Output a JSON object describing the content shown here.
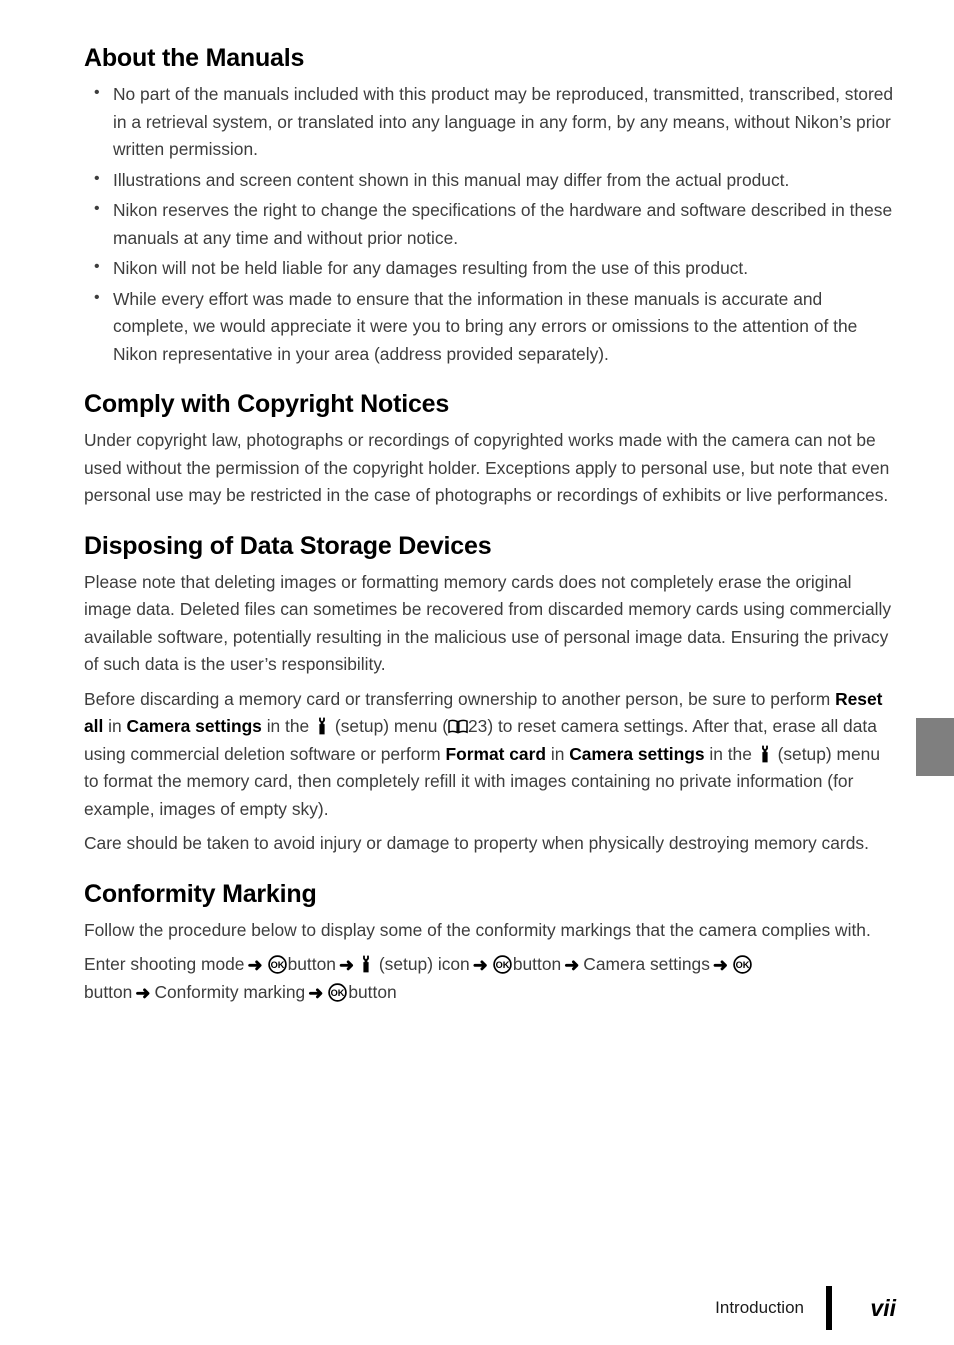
{
  "page": {
    "number": "vii",
    "footer_label": "Introduction"
  },
  "icons": {
    "wrench": "wrench-setup-icon",
    "book": "open-book-reference-icon",
    "ok": "ok-button-icon",
    "arrow": "right-arrow-icon",
    "bullet": "bullet-point"
  },
  "colors": {
    "heading": "#000000",
    "body": "#3d3d3d",
    "tab": "#7f7f7f",
    "footer_rule": "#000000"
  },
  "sections": [
    {
      "heading": "About the Manuals",
      "bullets": [
        "No part of the manuals included with this product may be reproduced, transmitted, transcribed, stored in a retrieval system, or translated into any language in any form, by any means, without Nikon’s prior written permission.",
        "Illustrations and screen content shown in this manual may differ from the actual product.",
        "Nikon reserves the right to change the specifications of the hardware and software described in these manuals at any time and without prior notice.",
        "Nikon will not be held liable for any damages resulting from the use of this product.",
        "While every effort was made to ensure that the information in these manuals is accurate and complete, we would appreciate it were you to bring any errors or omissions to the attention of the Nikon representative in your area (address provided separately)."
      ]
    },
    {
      "heading": "Comply with Copyright Notices",
      "paragraphs": [
        "Under copyright law, photographs or recordings of copyrighted works made with the camera can not be used without the permission of the copyright holder. Exceptions apply to personal use, but note that even personal use may be restricted in the case of photographs or recordings of exhibits or live performances."
      ]
    },
    {
      "heading": "Disposing of Data Storage Devices",
      "paragraphs": [
        "Please note that deleting images or formatting memory cards does not completely erase the original image data. Deleted files can sometimes be recovered from discarded memory cards using commercially available software, potentially resulting in the malicious use of personal image data. Ensuring the privacy of such data is the user’s responsibility.",
        "Care should be taken to avoid injury or damage to property when physically destroying memory cards."
      ]
    },
    {
      "heading": "Conformity Marking",
      "paragraphs": [
        "Follow the procedure below to display some of the conformity markings that the camera complies with."
      ]
    }
  ],
  "disposing_rich": {
    "p2_t1": "Before discarding a memory card or transferring ownership to another person, be sure to perform ",
    "p2_b1": "Reset all",
    "p2_t2": " in ",
    "p2_b2": "Camera settings",
    "p2_t3": " in the ",
    "p2_t4": " (setup) menu (",
    "p2_page_ref": "23",
    "p2_t5": ") to reset camera settings. After that, erase all data using commercial deletion software or perform ",
    "p2_b3": "Format card",
    "p2_t6": " in ",
    "p2_b4": "Camera settings",
    "p2_t7": " in the ",
    "p2_t8": " (setup) menu to format the memory card, then completely refill it with images containing no private information (for example, images of empty sky)."
  },
  "conformity_steps": {
    "s1": "Enter shooting mode",
    "s2": "button",
    "s3": "(setup) icon",
    "s4": "button",
    "s5": "Camera settings",
    "s6": "button",
    "s7": "Conformity marking",
    "s8": "button",
    "arrow": "➜"
  }
}
